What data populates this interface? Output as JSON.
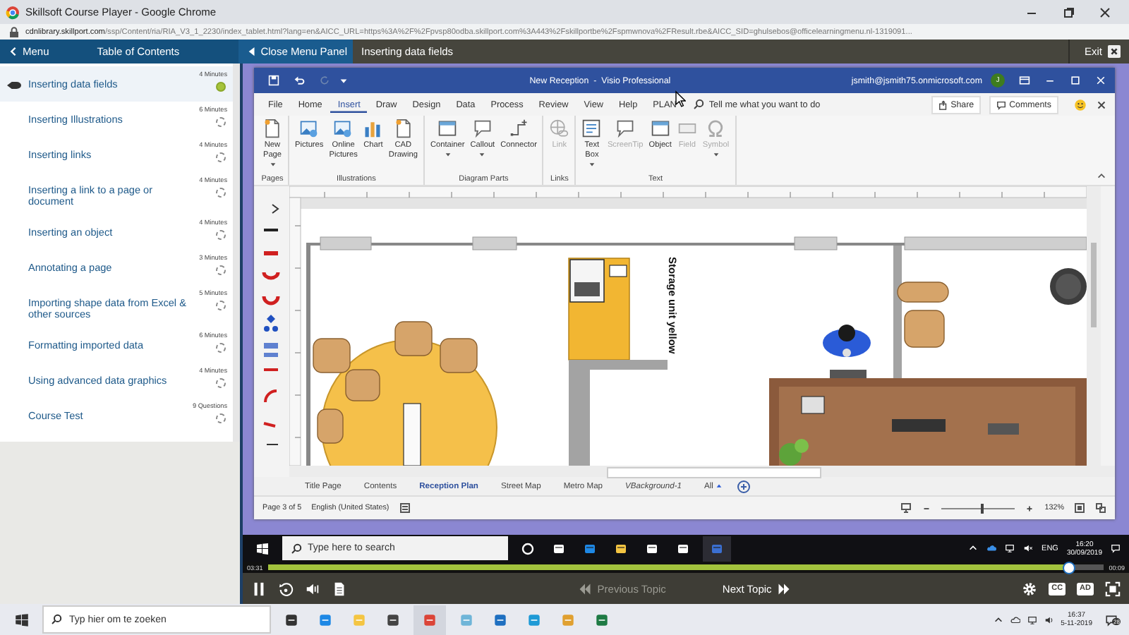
{
  "browser": {
    "title": "Skillsoft Course Player - Google Chrome",
    "url_domain": "cdnlibrary.skillport.com",
    "url_path": "/ssp/Content/ria/RIA_V3_1_2230/index_tablet.html?lang=en&AICC_URL=https%3A%2F%2Fpvsp80odba.skillport.com%3A443%2Fskillportbe%2Fspmwnova%2FResult.rbe&AICC_SID=ghulsebos@officelearningmenu.nl-1319091..."
  },
  "player_header": {
    "menu": "Menu",
    "toc_title": "Table of Contents",
    "close_panel": "Close Menu Panel",
    "topic_title": "Inserting data fields",
    "exit": "Exit"
  },
  "toc": [
    {
      "title": "Inserting data fields",
      "duration": "4 Minutes",
      "selected": true,
      "completed": true
    },
    {
      "title": "Inserting Illustrations",
      "duration": "6 Minutes",
      "selected": false,
      "completed": false
    },
    {
      "title": "Inserting links",
      "duration": "4 Minutes",
      "selected": false,
      "completed": false
    },
    {
      "title": "Inserting a link to a page or document",
      "duration": "4 Minutes",
      "selected": false,
      "completed": false
    },
    {
      "title": "Inserting an object",
      "duration": "4 Minutes",
      "selected": false,
      "completed": false
    },
    {
      "title": "Annotating a page",
      "duration": "3 Minutes",
      "selected": false,
      "completed": false
    },
    {
      "title": "Importing shape data from Excel & other sources",
      "duration": "5 Minutes",
      "selected": false,
      "completed": false
    },
    {
      "title": "Formatting imported data",
      "duration": "6 Minutes",
      "selected": false,
      "completed": false
    },
    {
      "title": "Using advanced data graphics",
      "duration": "4 Minutes",
      "selected": false,
      "completed": false
    },
    {
      "title": "Course Test",
      "duration": "9 Questions",
      "selected": false,
      "completed": false
    }
  ],
  "visio": {
    "title": "New Reception  -  Visio Professional",
    "account": "jsmith@jsmith75.onmicrosoft.com",
    "avatar_initial": "J",
    "menu_tabs": [
      {
        "label": "File",
        "selected": false
      },
      {
        "label": "Home",
        "selected": false
      },
      {
        "label": "Insert",
        "selected": true
      },
      {
        "label": "Draw",
        "selected": false
      },
      {
        "label": "Design",
        "selected": false
      },
      {
        "label": "Data",
        "selected": false
      },
      {
        "label": "Process",
        "selected": false
      },
      {
        "label": "Review",
        "selected": false
      },
      {
        "label": "View",
        "selected": false
      },
      {
        "label": "Help",
        "selected": false
      },
      {
        "label": "PLAN",
        "selected": false
      }
    ],
    "tell_me": {
      "placeholder": "Tell me what you want to do"
    },
    "share": "Share",
    "comments": "Comments",
    "ribbon_groups": [
      {
        "label": "Pages",
        "items": [
          {
            "label": "New Page",
            "disabled": false,
            "dropdown": true
          }
        ]
      },
      {
        "label": "Illustrations",
        "items": [
          {
            "label": "Pictures",
            "disabled": false,
            "dropdown": false
          },
          {
            "label": "Online Pictures",
            "disabled": false,
            "dropdown": false
          },
          {
            "label": "Chart",
            "disabled": false,
            "dropdown": false
          },
          {
            "label": "CAD Drawing",
            "disabled": false,
            "dropdown": false
          }
        ]
      },
      {
        "label": "Diagram Parts",
        "items": [
          {
            "label": "Container",
            "disabled": false,
            "dropdown": true
          },
          {
            "label": "Callout",
            "disabled": false,
            "dropdown": true
          },
          {
            "label": "Connector",
            "disabled": false,
            "dropdown": false
          }
        ]
      },
      {
        "label": "Links",
        "items": [
          {
            "label": "Link",
            "disabled": true,
            "dropdown": false
          }
        ]
      },
      {
        "label": "Text",
        "items": [
          {
            "label": "Text Box",
            "disabled": false,
            "dropdown": true
          },
          {
            "label": "ScreenTip",
            "disabled": true,
            "dropdown": false
          },
          {
            "label": "Object",
            "disabled": false,
            "dropdown": false
          },
          {
            "label": "Field",
            "disabled": true,
            "dropdown": false
          },
          {
            "label": "Symbol",
            "disabled": true,
            "dropdown": true
          }
        ]
      }
    ],
    "canvas_label": "Storage unit yellow",
    "page_tabs": [
      {
        "label": "Title Page",
        "selected": false
      },
      {
        "label": "Contents",
        "selected": false
      },
      {
        "label": "Reception Plan",
        "selected": true
      },
      {
        "label": "Street Map",
        "selected": false
      },
      {
        "label": "Metro Map",
        "selected": false
      },
      {
        "label": "VBackground-1",
        "selected": false
      }
    ],
    "all_pages": "All",
    "status": {
      "page": "Page 3 of 5",
      "language": "English (United States)",
      "zoom": "132%",
      "zoom_level": {
        "level": 0.55
      }
    }
  },
  "inner_taskbar": {
    "search": {
      "placeholder": "Type here to search"
    },
    "language": "ENG",
    "time": "16:20",
    "date": "30/09/2019"
  },
  "player_controls": {
    "elapsed": "03:31",
    "remaining": "00:09",
    "progress": {
      "level": 0.96
    },
    "previous": {
      "label": "Previous Topic",
      "disabled": true
    },
    "next": {
      "label": "Next Topic",
      "disabled": false
    },
    "captions": "CC",
    "audio_description": "AD"
  },
  "outer_taskbar": {
    "search": {
      "placeholder": "Typ hier om te zoeken"
    },
    "time": "16:37",
    "date": "5-11-2019",
    "notifications": "28"
  }
}
